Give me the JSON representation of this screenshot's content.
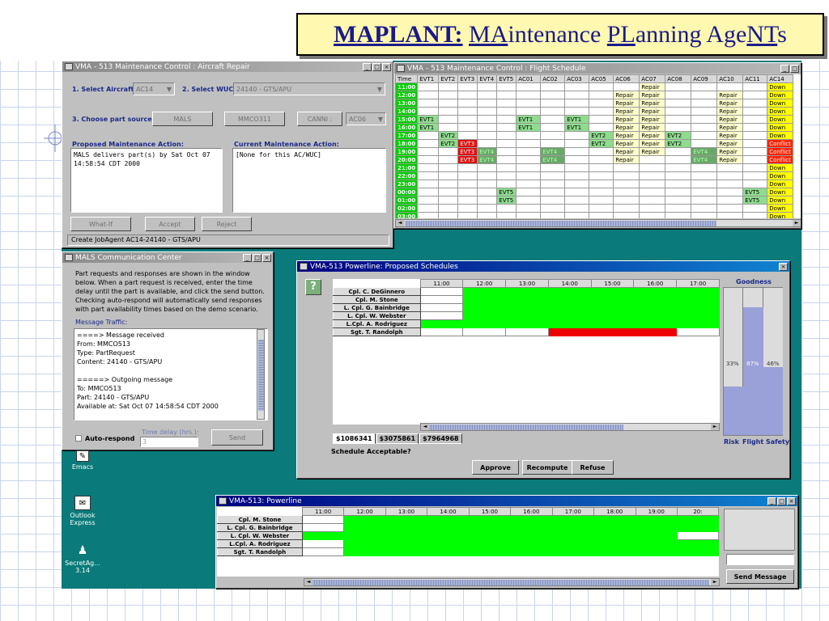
{
  "slide": {
    "title_bold": "MAPLANT:",
    "title_parts": [
      "MA",
      "intenance ",
      "PL",
      "anning Age",
      "NT",
      "s"
    ]
  },
  "repair": {
    "title": "VMA - 513 Maintenance Control : Aircraft Repair",
    "step1": "1. Select Aircraft:",
    "aircraft": "AC14",
    "step2": "2. Select WUC:",
    "wuc": "24140 - GTS/APU",
    "step3": "3. Choose part source:",
    "src1": "MALS",
    "src2": "MMCO311",
    "src3": "CANNI :",
    "src3_val": "AC06",
    "proposed_label": "Proposed Maintenance Action:",
    "proposed_text": "MALS delivers part(s) by Sat Oct 07\n14:58:54 CDT 2000",
    "current_label": "Current Maintenance Action:",
    "current_text": "[None for this AC/WUC]",
    "whatif": "What-If",
    "accept": "Accept",
    "reject": "Reject",
    "status": "Create JobAgent AC14-24140 - GTS/APU"
  },
  "flight": {
    "title": "VMA - 513 Maintenance Control : Flight Schedule",
    "headers": [
      "Time",
      "EVT1",
      "EVT2",
      "EVT3",
      "EVT4",
      "EVT5",
      "AC01",
      "AC02",
      "AC03",
      "AC05",
      "AC06",
      "AC07",
      "AC08",
      "AC09",
      "AC10",
      "AC11",
      "AC14"
    ],
    "times": [
      "11:00",
      "12:00",
      "13:00",
      "14:00",
      "15:00",
      "16:00",
      "17:00",
      "18:00",
      "19:00",
      "20:00",
      "21:00",
      "22:00",
      "23:00",
      "00:00",
      "01:00",
      "02:00",
      "03:00"
    ]
  },
  "mals": {
    "title": "MALS Communication Center",
    "intro": "Part requests and responses are shown in the window below.  When a part request is received, enter the time delay until the part is available, and click the send button. Checking auto-respond will automatically send responses with part availability times based on  the demo scenario.",
    "traffic_label": "Message Traffic:",
    "traffic": "====> Message received\nFrom: MMCO513\nType: PartRequest\nContent: 24140 - GTS/APU\n\n=====> Outgoing message\nTo: MMCO513\nPart: 24140 - GTS/APU\nAvailable at: Sat Oct 07 14:58:54 CDT 2000",
    "auto": "Auto-respond",
    "delay_label": "Time delay (hrs.):",
    "delay_val": "3",
    "send": "Send"
  },
  "desktop": {
    "emacs": "Emacs",
    "outlook1": "Outlook",
    "outlook2": "Express",
    "secret1": "SecretAg...",
    "secret2": "3.14"
  },
  "proposed": {
    "title": "VMA-513 Powerline:  Proposed Schedules",
    "hours": [
      "11:00",
      "12:00",
      "13:00",
      "14:00",
      "15:00",
      "16:00",
      "17:00"
    ],
    "people": [
      "Cpl. C. DeGinnero",
      "Cpl. M. Stone",
      "L. Cpl. G. Bainbridge",
      "L. Cpl. W. Webster",
      "L.Cpl. A. Rodriguez",
      "Sgt. T. Randolph"
    ],
    "goodness": "Goodness",
    "pct": [
      "33%",
      "87%",
      "46%"
    ],
    "pct_values": [
      0.33,
      0.87,
      0.46
    ],
    "risk": "Risk",
    "flight_safety": "Flight Safety",
    "tabs": [
      "$1086341",
      "$3075861",
      "$7964968"
    ],
    "question": "Schedule Acceptable?",
    "approve": "Approve",
    "recompute": "Recompute",
    "refuse": "Refuse"
  },
  "powerline": {
    "title": "VMA-513:  Powerline",
    "hours": [
      "11:00",
      "12:00",
      "13:00",
      "14:00",
      "15:00",
      "16:00",
      "17:00",
      "18:00",
      "19:00",
      "20:"
    ],
    "people": [
      "Cpl. M. Stone",
      "L. Cpl. G. Bainbridge",
      "L. Cpl. W. Webster",
      "L.Cpl. A. Rodriguez",
      "Sgt. T. Randolph"
    ],
    "send": "Send Message"
  }
}
